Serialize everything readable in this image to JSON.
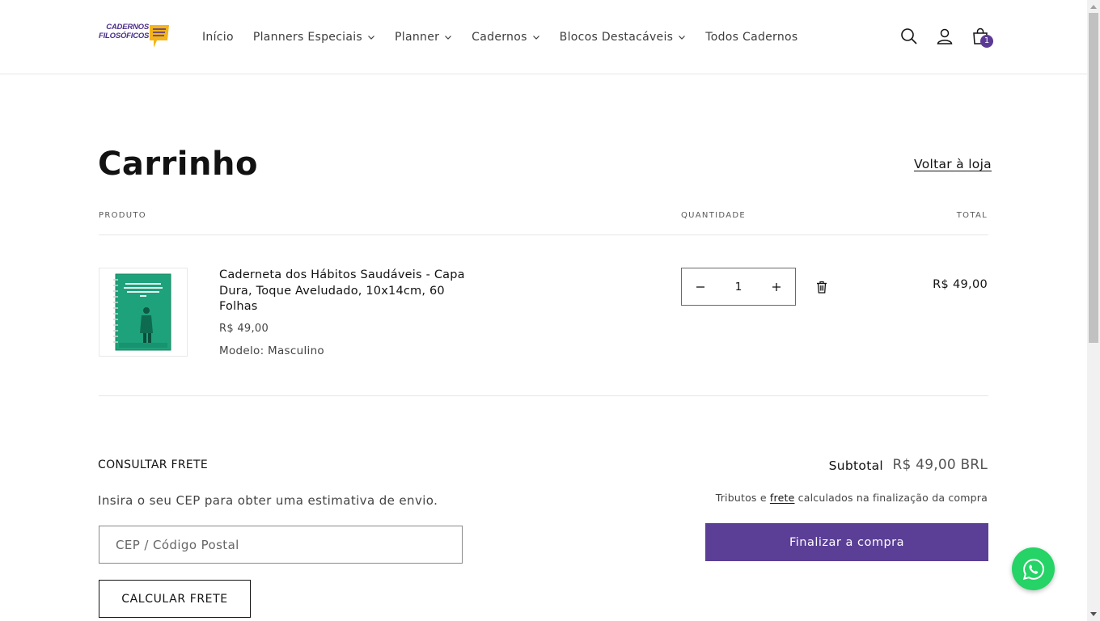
{
  "brand": {
    "line1": "CADERNOS",
    "line2": "FILOSÓFICOS",
    "accent": "#f4b41a",
    "primary": "#4b2e8a"
  },
  "nav": {
    "items": [
      {
        "label": "Início",
        "icon": null
      },
      {
        "label": "Planners Especiais",
        "icon": "chevron-down-icon"
      },
      {
        "label": "Planner",
        "icon": "chevron-down-icon"
      },
      {
        "label": "Cadernos",
        "icon": "chevron-down-icon"
      },
      {
        "label": "Blocos Destacáveis",
        "icon": "chevron-down-icon"
      },
      {
        "label": "Todos Cadernos",
        "icon": null
      }
    ]
  },
  "header_icons": {
    "search": "search-icon",
    "account": "user-icon",
    "cart": "cart-icon",
    "cart_count": "1"
  },
  "cart": {
    "title": "Carrinho",
    "back_link": "Voltar à loja",
    "columns": {
      "product": "PRODUTO",
      "quantity": "QUANTIDADE",
      "total": "TOTAL"
    },
    "items": [
      {
        "name": "Caderneta dos Hábitos Saudáveis - Capa Dura, Toque Aveludado, 10x14cm, 60 Folhas",
        "price": "R$ 49,00",
        "option": "Modelo: Masculino",
        "quantity": "1",
        "line_total": "R$ 49,00",
        "cover_color": "#1aa37a"
      }
    ]
  },
  "shipping": {
    "title": "CONSULTAR FRETE",
    "description": "Insira o seu CEP para obter uma estimativa de envio.",
    "placeholder": "CEP / Código Postal",
    "button": "CALCULAR FRETE"
  },
  "summary": {
    "subtotal_label": "Subtotal",
    "subtotal_value": "R$ 49,00 BRL",
    "taxes_prefix": "Tributos e",
    "taxes_link": "frete",
    "taxes_suffix": "calculados na finalização da compra",
    "checkout": "Finalizar a compra",
    "checkout_color": "#5b3f96"
  },
  "whatsapp": {
    "icon": "whatsapp-icon",
    "color": "#25d366"
  }
}
